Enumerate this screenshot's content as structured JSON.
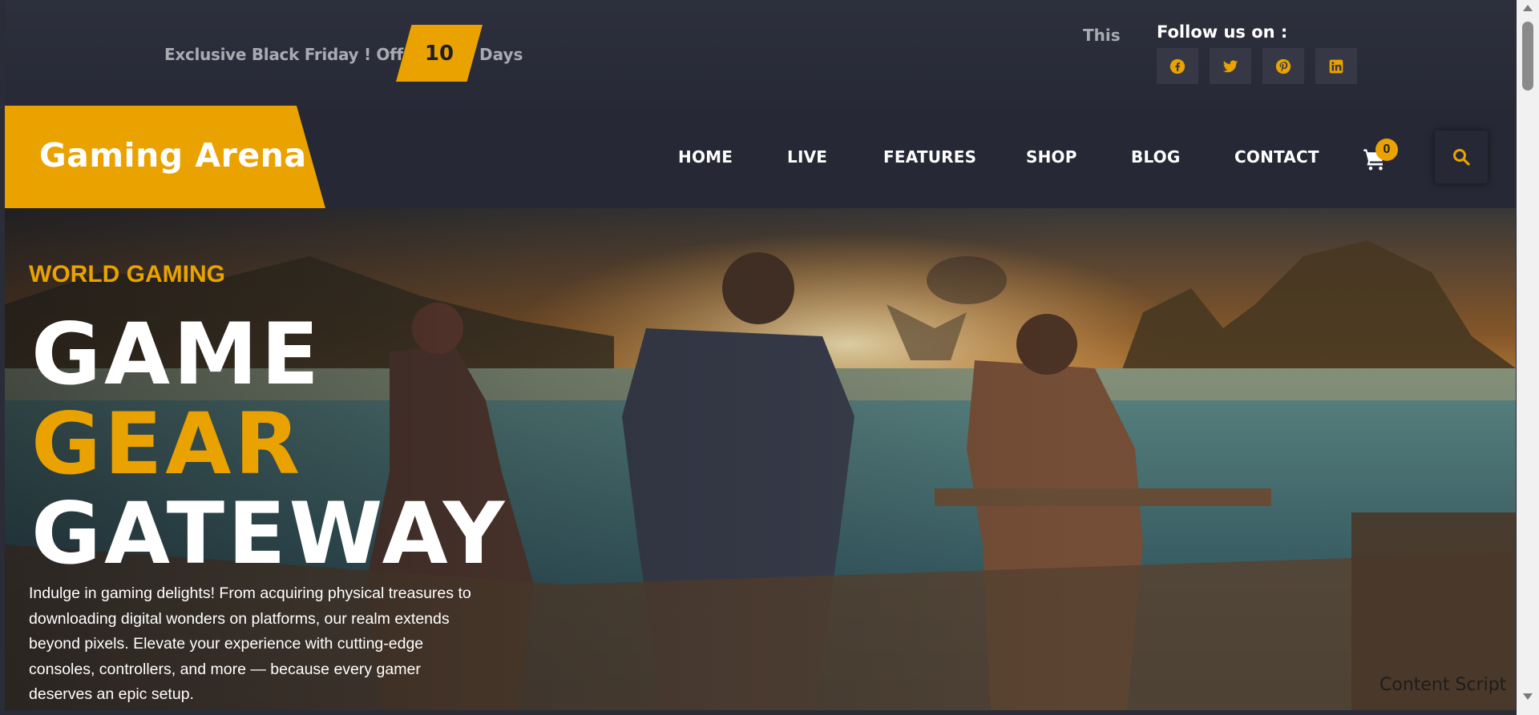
{
  "topbar": {
    "offer_text": "Exclusive Black Friday ! Offer",
    "offer_count": "10",
    "offer_unit": "Days",
    "ticker_text": "This is",
    "follow_label": "Follow us on :",
    "socials": [
      {
        "name": "facebook-icon"
      },
      {
        "name": "twitter-icon"
      },
      {
        "name": "pinterest-icon"
      },
      {
        "name": "linkedin-icon"
      }
    ]
  },
  "nav": {
    "logo": "Gaming Arena",
    "items": [
      "HOME",
      "LIVE",
      "FEATURES",
      "SHOP",
      "BLOG",
      "CONTACT"
    ],
    "cart_count": "0"
  },
  "hero": {
    "eyebrow": "WORLD GAMING",
    "line1": "GAME",
    "line2": "GEAR",
    "line3": "GATEWAY",
    "description": "Indulge in gaming delights! From acquiring physical treasures to downloading digital wonders on platforms, our realm extends beyond pixels. Elevate your experience with cutting-edge consoles, controllers, and more — because every gamer deserves an epic setup."
  },
  "footer_note": "Content Script",
  "colors": {
    "accent": "#e9a200",
    "background": "#262835",
    "social_bg": "#363945",
    "text": "#ffffff"
  }
}
